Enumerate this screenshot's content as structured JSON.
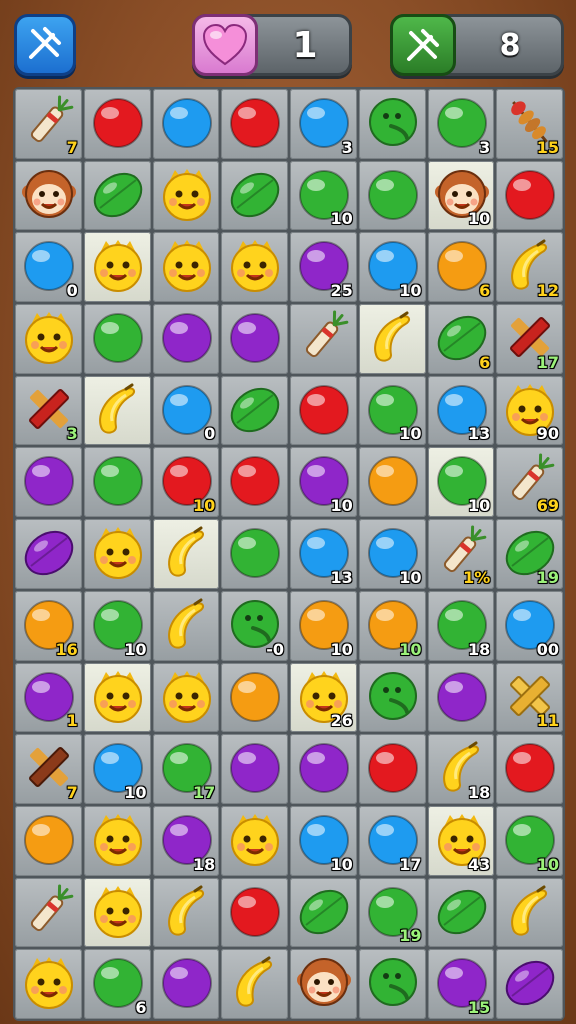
{
  "hud": {
    "tool_button": {
      "icon": "hammer-icon"
    },
    "lives": {
      "icon": "heart-icon",
      "value": "1"
    },
    "moves": {
      "icon": "hammer-icon",
      "value": "8"
    }
  },
  "colors": {
    "red": "#e3191f",
    "blue": "#1e9bf0",
    "green": "#32b334",
    "purple": "#8f26c9",
    "orange": "#f59c12",
    "yellow": "#ffd31d",
    "cell": "#a9aeb1",
    "cell_light": "#e4e6da"
  },
  "board": {
    "columns": 8,
    "rows": [
      [
        {
          "p": "firework",
          "n": "7",
          "c": "y"
        },
        {
          "p": "red"
        },
        {
          "p": "blue"
        },
        {
          "p": "red"
        },
        {
          "p": "blue",
          "n": "3"
        },
        {
          "p": "green-face"
        },
        {
          "p": "green",
          "n": "3"
        },
        {
          "p": "kebab",
          "n": "15",
          "c": "y"
        }
      ],
      [
        {
          "p": "monkey"
        },
        {
          "p": "green-leaf"
        },
        {
          "p": "yellow-face"
        },
        {
          "p": "green-leaf"
        },
        {
          "p": "green",
          "n": "10"
        },
        {
          "p": "green"
        },
        {
          "p": "monkey",
          "n": "10",
          "bg": "light"
        },
        {
          "p": "red"
        }
      ],
      [
        {
          "p": "blue",
          "n": "0"
        },
        {
          "p": "yellow-face",
          "bg": "light"
        },
        {
          "p": "yellow-face"
        },
        {
          "p": "yellow-face"
        },
        {
          "p": "purple",
          "n": "25"
        },
        {
          "p": "blue",
          "n": "10"
        },
        {
          "p": "orange",
          "n": "6",
          "c": "y"
        },
        {
          "p": "banana",
          "n": "12",
          "c": "y"
        }
      ],
      [
        {
          "p": "yellow-face"
        },
        {
          "p": "green"
        },
        {
          "p": "purple"
        },
        {
          "p": "purple"
        },
        {
          "p": "firework"
        },
        {
          "p": "banana",
          "bg": "light"
        },
        {
          "p": "green-leaf",
          "n": "6",
          "c": "y"
        },
        {
          "p": "stick-red",
          "n": "17",
          "c": "g"
        }
      ],
      [
        {
          "p": "stick-red",
          "n": "3",
          "c": "g"
        },
        {
          "p": "banana",
          "bg": "light"
        },
        {
          "p": "blue",
          "n": "0"
        },
        {
          "p": "green-leaf"
        },
        {
          "p": "red"
        },
        {
          "p": "green",
          "n": "10"
        },
        {
          "p": "blue",
          "n": "13"
        },
        {
          "p": "yellow-face",
          "n": "90"
        }
      ],
      [
        {
          "p": "purple"
        },
        {
          "p": "green"
        },
        {
          "p": "red",
          "n": "10",
          "c": "y"
        },
        {
          "p": "red"
        },
        {
          "p": "purple",
          "n": "10"
        },
        {
          "p": "orange"
        },
        {
          "p": "green",
          "n": "10",
          "bg": "light"
        },
        {
          "p": "firework",
          "n": "69",
          "c": "y"
        }
      ],
      [
        {
          "p": "purple-leaf"
        },
        {
          "p": "yellow-face"
        },
        {
          "p": "banana",
          "bg": "light"
        },
        {
          "p": "green"
        },
        {
          "p": "blue",
          "n": "13"
        },
        {
          "p": "blue",
          "n": "10"
        },
        {
          "p": "firework",
          "n": "1%",
          "c": "y"
        },
        {
          "p": "green-leaf",
          "n": "19",
          "c": "g"
        }
      ],
      [
        {
          "p": "orange",
          "n": "16",
          "c": "y"
        },
        {
          "p": "green",
          "n": "10"
        },
        {
          "p": "banana"
        },
        {
          "p": "green-face",
          "n": "-0"
        },
        {
          "p": "orange",
          "n": "10"
        },
        {
          "p": "orange",
          "n": "10",
          "c": "g"
        },
        {
          "p": "green",
          "n": "18"
        },
        {
          "p": "blue",
          "n": "00"
        }
      ],
      [
        {
          "p": "purple",
          "n": "1",
          "c": "y"
        },
        {
          "p": "yellow-face",
          "bg": "light"
        },
        {
          "p": "yellow-face"
        },
        {
          "p": "orange"
        },
        {
          "p": "yellow-face",
          "n": "26",
          "bg": "light"
        },
        {
          "p": "green-face"
        },
        {
          "p": "purple"
        },
        {
          "p": "stick-yellow",
          "n": "11",
          "c": "y"
        }
      ],
      [
        {
          "p": "stick-brown",
          "n": "7",
          "c": "y"
        },
        {
          "p": "blue",
          "n": "10"
        },
        {
          "p": "green",
          "n": "17",
          "c": "g"
        },
        {
          "p": "purple"
        },
        {
          "p": "purple"
        },
        {
          "p": "red"
        },
        {
          "p": "banana",
          "n": "18"
        },
        {
          "p": "red"
        }
      ],
      [
        {
          "p": "orange"
        },
        {
          "p": "yellow-face"
        },
        {
          "p": "purple",
          "n": "18"
        },
        {
          "p": "yellow-face"
        },
        {
          "p": "blue",
          "n": "10"
        },
        {
          "p": "blue",
          "n": "17"
        },
        {
          "p": "yellow-face",
          "n": "43",
          "bg": "light"
        },
        {
          "p": "green",
          "n": "10",
          "c": "g"
        }
      ],
      [
        {
          "p": "firework"
        },
        {
          "p": "yellow-face",
          "bg": "light"
        },
        {
          "p": "banana"
        },
        {
          "p": "red"
        },
        {
          "p": "green-leaf"
        },
        {
          "p": "green",
          "n": "19",
          "c": "g"
        },
        {
          "p": "green-leaf"
        },
        {
          "p": "banana"
        }
      ],
      [
        {
          "p": "yellow-face"
        },
        {
          "p": "green",
          "n": "6"
        },
        {
          "p": "purple"
        },
        {
          "p": "banana"
        },
        {
          "p": "monkey"
        },
        {
          "p": "green-face"
        },
        {
          "p": "purple",
          "n": "15",
          "c": "g"
        },
        {
          "p": "purple-leaf"
        }
      ]
    ]
  }
}
